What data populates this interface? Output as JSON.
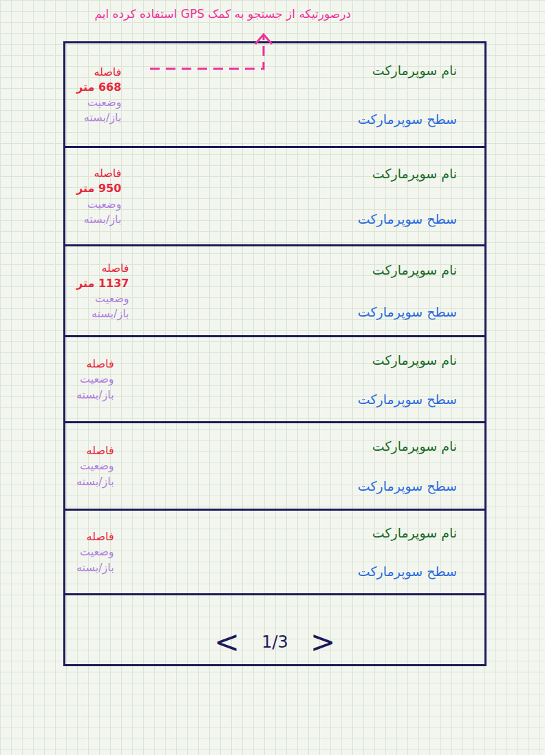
{
  "annotation": {
    "text": "درصورتیکه از جستجو به کمک GPS استفاده کرده ایم"
  },
  "rows": [
    {
      "name": "نام سوپرمارکت",
      "level_label": "سطح سوپرمارکت",
      "distance_label": "فاصله",
      "distance": "668 متر",
      "status_label": "وضعیت",
      "status": "باز/بسته"
    },
    {
      "name": "نام سوپرمارکت",
      "level_label": "سطح سوپرمارکت",
      "distance_label": "فاصله",
      "distance": "950 متر",
      "status_label": "وضعیت",
      "status": "باز/بسته"
    },
    {
      "name": "نام سوپرمارکت",
      "level_label": "سطح سوپرمارکت",
      "distance_label": "فاصله",
      "distance": "1137 متر",
      "status_label": "وضعیت",
      "status": "باز/بسته"
    },
    {
      "name": "نام سوپرمارکت",
      "level_label": "سطح سوپرمارکت",
      "distance_label": "فاصله",
      "distance": "",
      "status_label": "وضعیت",
      "status": "باز/بسته"
    },
    {
      "name": "نام سوپرمارکت",
      "level_label": "سطح سوپرمارکت",
      "distance_label": "فاصله",
      "distance": "",
      "status_label": "وضعیت",
      "status": "باز/بسته"
    },
    {
      "name": "نام سوپرمارکت",
      "level_label": "سطح سوپرمارکت",
      "distance_label": "فاصله",
      "distance": "",
      "status_label": "وضعیت",
      "status": "باز/بسته"
    }
  ],
  "pagination": {
    "prev": "<",
    "page": "1/3",
    "next": ">"
  }
}
